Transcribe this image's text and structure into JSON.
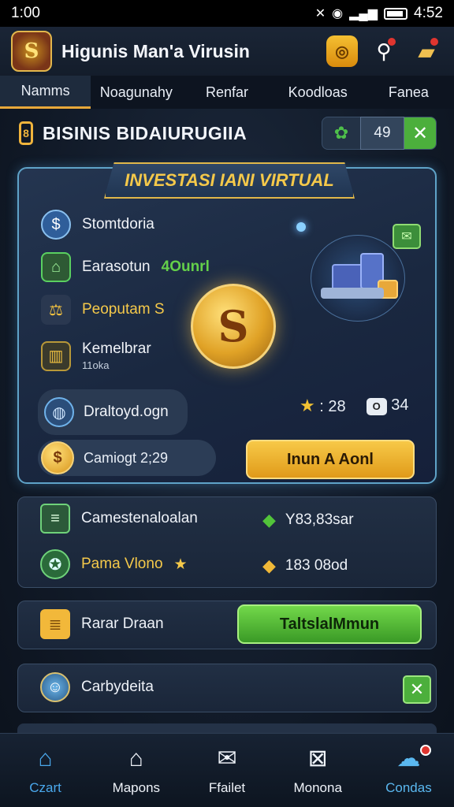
{
  "status": {
    "time": "1:00",
    "clock": "4:52"
  },
  "header": {
    "title": "Higunis Man'a Virusin",
    "logo_letter": "S"
  },
  "tabs": [
    "Namms",
    "Noagunahy",
    "Renfar",
    "Koodloas",
    "Fanea"
  ],
  "section": {
    "title": "BISINIS BIDAIURUGIIA",
    "count": "49"
  },
  "invest": {
    "banner": "INVESTASI IANI VIRTUAL",
    "items": [
      {
        "label": "Stomtdoria"
      },
      {
        "label": "Earasotun",
        "value": "4Ounrl"
      },
      {
        "label": "Peoputam S"
      },
      {
        "label": "Kemelbrar",
        "sublabel": "11oka"
      },
      {
        "label": "Draltoyd.ogn"
      }
    ],
    "rating": "28",
    "extra": "34",
    "coin_label": "Camiogt 2;29",
    "button": "Inun A Aonl"
  },
  "panel1": {
    "rows": [
      {
        "label": "Camestenaloalan",
        "value": "Y83,83sar"
      },
      {
        "label": "Pama Vlono",
        "value": "183 08od"
      }
    ]
  },
  "panel2": {
    "label": "Rarar Draan",
    "button": "TaltslalMmun"
  },
  "panel3": {
    "label": "Carbydeita"
  },
  "nav": [
    "Czart",
    "Mapons",
    "Ffailet",
    "Monona",
    "Condas"
  ],
  "colors": {
    "accent": "#e8a83a",
    "gold": "#f5c94a",
    "green": "#4caf3c",
    "panel_border": "#5fa3c8"
  }
}
